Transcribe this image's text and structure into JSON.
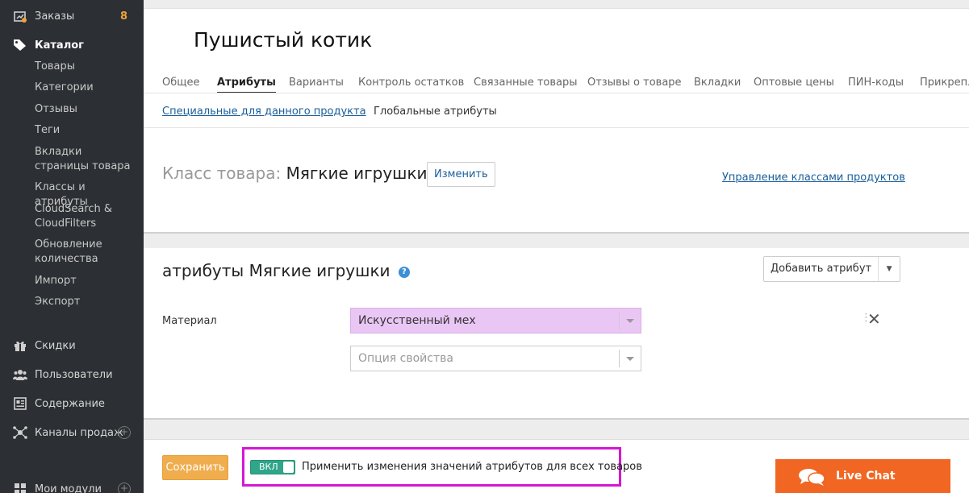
{
  "sidebar": {
    "orders": {
      "label": "Заказы",
      "badge": "8"
    },
    "catalog": {
      "label": "Каталог"
    },
    "catalog_items": [
      "Товары",
      "Категории",
      "Отзывы",
      "Теги",
      "Вкладки страницы товара",
      "Классы и атрибуты",
      "CloudSearch & CloudFilters",
      "Обновление количества",
      "Импорт",
      "Экспорт"
    ],
    "discounts": {
      "label": "Скидки"
    },
    "users": {
      "label": "Пользователи"
    },
    "content": {
      "label": "Содержание"
    },
    "sales_channels": {
      "label": "Каналы продаж"
    },
    "my_modules": {
      "label": "Мои модули"
    }
  },
  "product": {
    "title": "Пушистый котик"
  },
  "tabs": [
    "Общее",
    "Атрибуты",
    "Варианты",
    "Контроль остатков",
    "Связанные товары",
    "Отзывы о товаре",
    "Вкладки",
    "Оптовые цены",
    "ПИН-коды",
    "Прикрепл"
  ],
  "subtabs": {
    "specific": "Специальные для данного продукта",
    "global": "Глобальные атрибуты"
  },
  "product_class": {
    "label": "Класс товара:",
    "value": "Мягкие игрушки",
    "change_button": "Изменить",
    "manage_link": "Управление классами продуктов"
  },
  "attributes": {
    "title": "атрибуты Мягкие игрушки",
    "help_icon": "?",
    "add_button": "Добавить атрибут",
    "row_label": "Материал",
    "selected_value": "Искусственный мех",
    "option_placeholder": "Опция свойства"
  },
  "bottom": {
    "save_button": "Сохранить",
    "toggle_label": "ВКЛ",
    "toggle_text": "Применить изменения значений атрибутов для всех товаров",
    "live_chat": "Live Chat"
  },
  "colors": {
    "highlight": "#d417d4",
    "save": "#f0ad4e",
    "toggle": "#2fa58a",
    "live_chat": "#f06622",
    "selected": "#eac6f5"
  }
}
